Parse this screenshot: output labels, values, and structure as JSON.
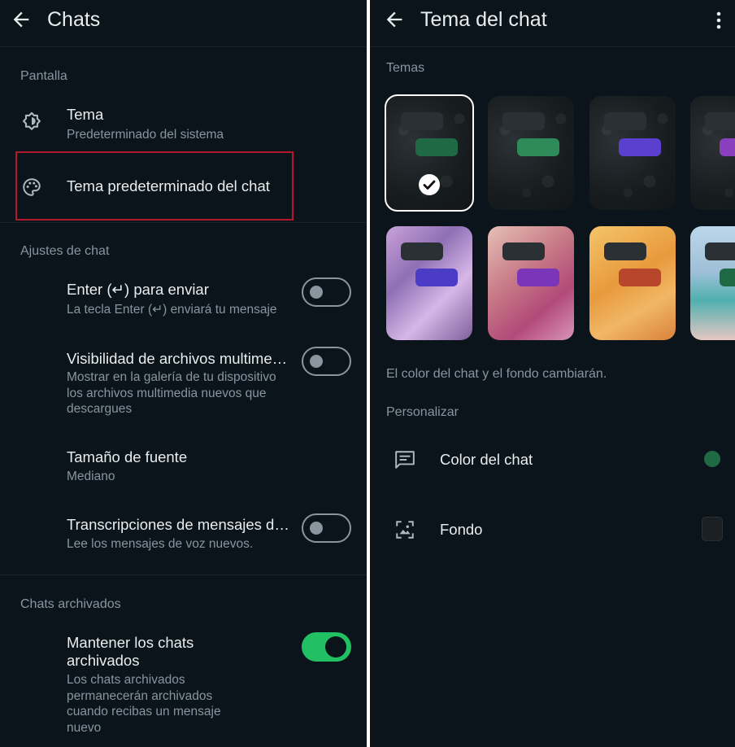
{
  "left": {
    "title": "Chats",
    "sections": {
      "display": "Pantalla",
      "chat_settings": "Ajustes de chat",
      "archived": "Chats archivados"
    },
    "theme": {
      "title": "Tema",
      "subtitle": "Predeterminado del sistema"
    },
    "default_chat_theme": {
      "title": "Tema predeterminado del chat"
    },
    "enter_to_send": {
      "title": "Enter (↵) para enviar",
      "subtitle": "La tecla Enter (↵) enviará tu mensaje",
      "enabled": false
    },
    "media_visibility": {
      "title": "Visibilidad de archivos multime…",
      "subtitle_lines": [
        "Mostrar en la galería de tu dispositivo",
        "los archivos multimedia nuevos que",
        "descargues"
      ],
      "enabled": false
    },
    "font_size": {
      "title": "Tamaño de fuente",
      "subtitle": "Mediano"
    },
    "voice_transcripts": {
      "title": "Transcripciones de mensajes d…",
      "subtitle": "Lee los mensajes de voz nuevos.",
      "enabled": false
    },
    "keep_archived": {
      "title_lines": [
        "Mantener los chats",
        "archivados"
      ],
      "subtitle_lines": [
        "Los chats archivados",
        "permanecerán archivados",
        "cuando recibas un mensaje",
        "nuevo"
      ],
      "enabled": true
    }
  },
  "right": {
    "title": "Tema del chat",
    "themes_label": "Temas",
    "note": "El color del chat y el fondo cambiarán.",
    "customize_label": "Personalizar",
    "chat_color_label": "Color del chat",
    "wallpaper_label": "Fondo",
    "chat_color_value": "#1f6a45",
    "themes": [
      {
        "style": "dark",
        "bubble": "#1f6a45",
        "selected": true
      },
      {
        "style": "dark",
        "bubble": "#2f8a5a",
        "selected": false
      },
      {
        "style": "dark",
        "bubble": "#5b3fcf",
        "selected": false
      },
      {
        "style": "dark",
        "bubble": "#8a3fbf",
        "selected": false
      },
      {
        "style": "purple",
        "bubble": "#4a3cc4",
        "selected": false
      },
      {
        "style": "pink",
        "bubble": "#7a35b8",
        "selected": false
      },
      {
        "style": "orange",
        "bubble": "#b8462a",
        "selected": false
      },
      {
        "style": "beach",
        "bubble": "#1f6a45",
        "selected": false
      }
    ]
  }
}
